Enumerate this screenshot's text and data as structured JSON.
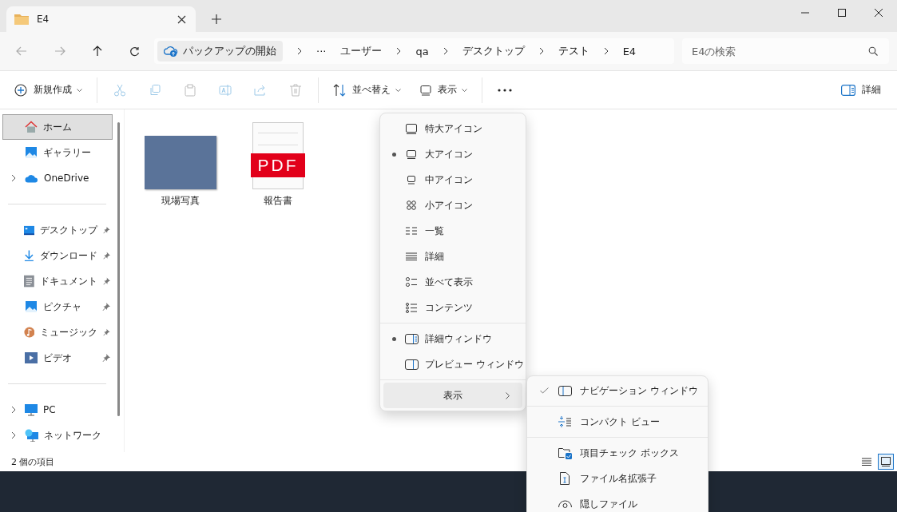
{
  "window": {
    "tab_title": "E4"
  },
  "address": {
    "backup_label": "パックアップの開始",
    "overflow": "···",
    "crumbs": [
      "ユーザー",
      "qa",
      "デスクトップ",
      "テスト",
      "E4"
    ]
  },
  "search": {
    "placeholder": "E4の検索"
  },
  "toolbar": {
    "groups": [
      [
        {
          "kind": "new",
          "label": "新規作成",
          "dropdown": true,
          "disabled": false
        }
      ],
      [
        {
          "kind": "cut",
          "disabled": true
        },
        {
          "kind": "copy",
          "disabled": true
        },
        {
          "kind": "paste",
          "disabled": true
        },
        {
          "kind": "rename",
          "disabled": true
        },
        {
          "kind": "share",
          "disabled": true
        },
        {
          "kind": "delete",
          "disabled": true
        }
      ],
      [
        {
          "kind": "sort",
          "label": "並べ替え",
          "dropdown": true,
          "disabled": false
        },
        {
          "kind": "view",
          "label": "表示",
          "dropdown": true,
          "disabled": false
        }
      ],
      [
        {
          "kind": "more",
          "disabled": false
        }
      ]
    ],
    "details": {
      "label": "詳細"
    }
  },
  "sidebar": {
    "groups": [
      [
        {
          "kind": "home",
          "label": "ホーム",
          "selected": true,
          "expandable": false,
          "pinned": false
        },
        {
          "kind": "gallery",
          "label": "ギャラリー",
          "selected": false,
          "expandable": false,
          "pinned": false
        },
        {
          "kind": "cloud",
          "label": "OneDrive",
          "selected": false,
          "expandable": true,
          "pinned": false
        }
      ],
      [
        {
          "kind": "desktop",
          "label": "デスクトップ",
          "selected": false,
          "expandable": false,
          "pinned": true
        },
        {
          "kind": "download",
          "label": "ダウンロード",
          "selected": false,
          "expandable": false,
          "pinned": true
        },
        {
          "kind": "document",
          "label": "ドキュメント",
          "selected": false,
          "expandable": false,
          "pinned": true
        },
        {
          "kind": "picture",
          "label": "ピクチャ",
          "selected": false,
          "expandable": false,
          "pinned": true
        },
        {
          "kind": "music",
          "label": "ミュージック",
          "selected": false,
          "expandable": false,
          "pinned": true
        },
        {
          "kind": "video",
          "label": "ビデオ",
          "selected": false,
          "expandable": false,
          "pinned": true
        }
      ],
      [
        {
          "kind": "pc",
          "label": "PC",
          "selected": false,
          "expandable": true,
          "pinned": false
        },
        {
          "kind": "network",
          "label": "ネットワーク",
          "selected": false,
          "expandable": true,
          "pinned": false
        }
      ]
    ]
  },
  "files": [
    {
      "name": "現場写真",
      "kind": "image"
    },
    {
      "name": "報告書",
      "kind": "pdf",
      "badge": "PDF"
    }
  ],
  "status_bar": {
    "count": "2 個の項目",
    "views": [
      {
        "kind": "details",
        "selected": false
      },
      {
        "kind": "tiles",
        "selected": true
      }
    ]
  },
  "view_menu": {
    "groups": [
      [
        {
          "kind": "xl",
          "label": "特大アイコン",
          "selected": false
        },
        {
          "kind": "large",
          "label": "大アイコン",
          "selected": true
        },
        {
          "kind": "medium",
          "label": "中アイコン",
          "selected": false
        },
        {
          "kind": "small",
          "label": "小アイコン",
          "selected": false
        },
        {
          "kind": "list",
          "label": "一覧",
          "selected": false
        },
        {
          "kind": "details",
          "label": "詳細",
          "selected": false
        },
        {
          "kind": "tiles",
          "label": "並べて表示",
          "selected": false
        },
        {
          "kind": "content",
          "label": "コンテンツ",
          "selected": false
        }
      ],
      [
        {
          "kind": "details-pane",
          "label": "詳細ウィンドウ",
          "selected": true
        },
        {
          "kind": "preview-pane",
          "label": "プレビュー ウィンドウ",
          "selected": false
        }
      ]
    ],
    "submenu_label": "表示"
  },
  "show_submenu": {
    "groups": [
      [
        {
          "kind": "nav-pane",
          "label": "ナビゲーション ウィンドウ",
          "checked": true
        }
      ],
      [
        {
          "kind": "compact",
          "label": "コンパクト ビュー",
          "checked": false
        }
      ],
      [
        {
          "kind": "checkboxes",
          "label": "項目チェック ボックス",
          "checked": false
        },
        {
          "kind": "extensions",
          "label": "ファイル名拡張子",
          "checked": false
        },
        {
          "kind": "hidden",
          "label": "隠しファイル",
          "checked": false
        }
      ]
    ]
  }
}
